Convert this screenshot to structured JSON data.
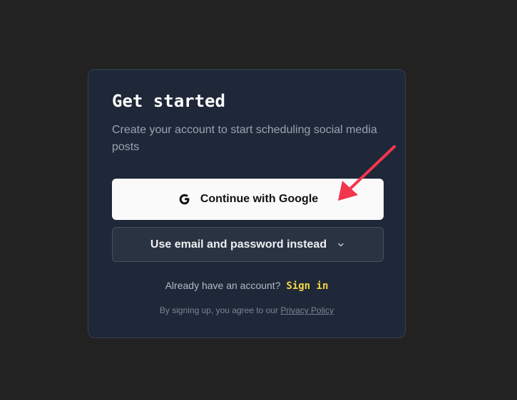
{
  "signup": {
    "title": "Get started",
    "subtitle": "Create your account to start scheduling social media posts",
    "google_button_label": "Continue with Google",
    "email_button_label": "Use email and password instead",
    "have_account_text": "Already have an account?",
    "sign_in_link": "Sign in",
    "terms_text": "By signing up, you agree to our",
    "privacy_link": "Privacy Policy"
  },
  "icons": {
    "google": "google-g-icon",
    "chevron": "chevron-down-icon",
    "annotation": "red-arrow-annotation"
  },
  "colors": {
    "page_background": "#222222",
    "card_background": "#1f2838",
    "google_button": "#fafafa",
    "email_button": "#2a3342",
    "sign_in_link": "#f5d547",
    "annotation_arrow": "#f2364d"
  }
}
